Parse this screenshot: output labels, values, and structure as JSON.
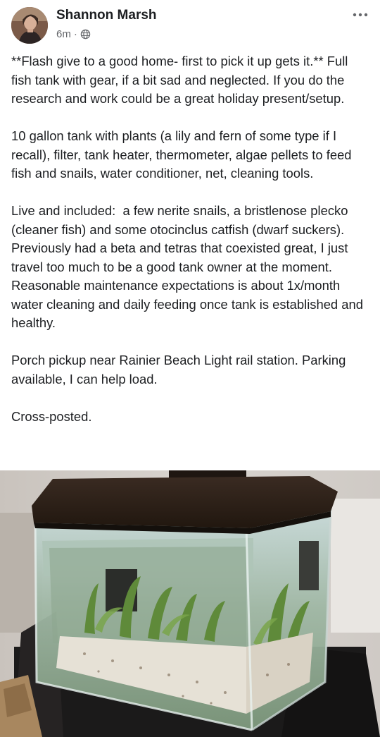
{
  "post": {
    "author": "Shannon Marsh",
    "timestamp": "6m",
    "separator": "·",
    "audience_icon": "globe-icon",
    "more_icon": "more-options-icon",
    "body": "**Flash give to a good home- first to pick it up gets it.** Full fish tank with gear, if a bit sad and neglected. If you do the research and work could be a great holiday present/setup.\n\n10 gallon tank with plants (a lily and fern of some type if I recall), filter, tank heater, thermometer, algae pellets to feed fish and snails, water conditioner, net, cleaning tools.\n\nLive and included:  a few nerite snails, a bristlenose plecko (cleaner fish) and some otocinclus catfish (dwarf suckers). Previously had a beta and tetras that coexisted great, I just travel too much to be a good tank owner at the moment. Reasonable maintenance expectations is about 1x/month water cleaning and daily feeding once tank is established and healthy.\n\nPorch pickup near Rainier Beach Light rail station. Parking available, I can help load.\n\nCross-posted."
  },
  "colors": {
    "text": "#1c1e21",
    "secondary_text": "#65676b",
    "background": "#ffffff"
  }
}
